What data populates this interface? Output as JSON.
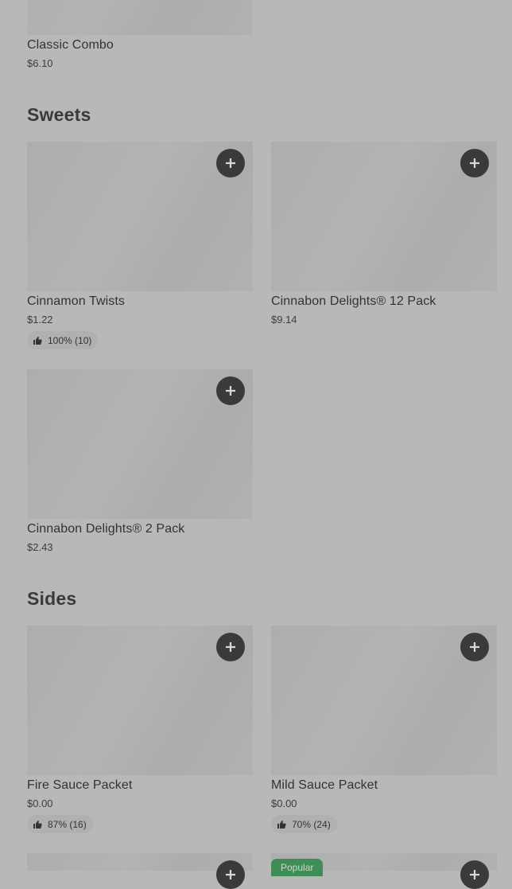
{
  "prev_section": {
    "item": {
      "name": "Classic Combo",
      "price": "$6.10"
    }
  },
  "sweets": {
    "title": "Sweets",
    "items": [
      {
        "name": "Cinnamon Twists",
        "price": "$1.22",
        "rating": "100% (10)"
      },
      {
        "name": "Cinnabon Delights® 12 Pack",
        "price": "$9.14"
      },
      {
        "name": "Cinnabon Delights® 2 Pack",
        "price": "$2.43"
      }
    ]
  },
  "sides": {
    "title": "Sides",
    "items": [
      {
        "name": "Fire Sauce Packet",
        "price": "$0.00",
        "rating": "87% (16)"
      },
      {
        "name": "Mild Sauce Packet",
        "price": "$0.00",
        "rating": "70% (24)"
      }
    ],
    "next_row_badge": "Popular"
  },
  "icons": {
    "add": "plus-icon",
    "rating": "thumbs-up-icon"
  },
  "colors": {
    "background": "#b8b8b8",
    "add_button": "#3a3a3a",
    "popular_badge": "#3f8e55"
  }
}
